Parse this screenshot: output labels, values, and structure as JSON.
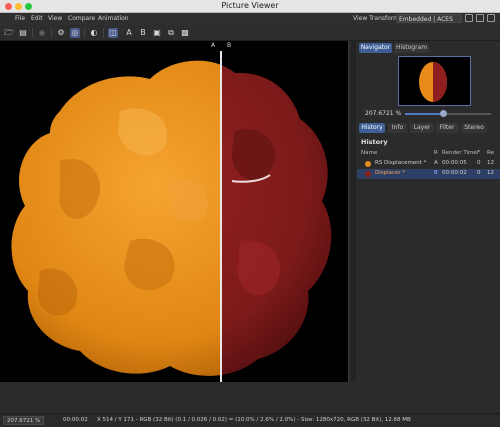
{
  "window": {
    "title": "Picture Viewer"
  },
  "menu": [
    "File",
    "Edit",
    "View",
    "Compare",
    "Animation"
  ],
  "view_transform": {
    "label": "View Transform",
    "value": "Embedded | ACES"
  },
  "viewer": {
    "label_a": "A",
    "label_b": "B"
  },
  "panel": {
    "top_tabs": [
      "Navigator",
      "Histogram"
    ],
    "zoom": "207.6721 %",
    "zoom_fraction": 0.45,
    "tabs": [
      "History",
      "Info",
      "Layer",
      "Filter",
      "Stereo"
    ],
    "history_title": "History",
    "history_columns": [
      "Name",
      "R",
      "Render Time",
      "F",
      "Re"
    ],
    "history_rows": [
      {
        "name": "RS Displacement *",
        "r": "A",
        "time": "00:00:05",
        "f": "0",
        "re": "12",
        "color": "#e8891a"
      },
      {
        "name": "Displacer *",
        "r": "B",
        "time": "00:00:02",
        "f": "0",
        "re": "12",
        "color": "#8e1e1e"
      }
    ]
  },
  "status": {
    "zoom": "207.6721 %",
    "time": "00:00:02",
    "info": "X 514 / Y 171 - RGB (32 Bit) (0.1 / 0.026 / 0.02) = (10.0% / 2.6% / 2.0%) - Size: 1280x720, RGB (32 Bit), 12.68 MB"
  },
  "colors": {
    "accent": "#3e5f96",
    "orange": "#e8891a",
    "red": "#8e1e1e"
  }
}
